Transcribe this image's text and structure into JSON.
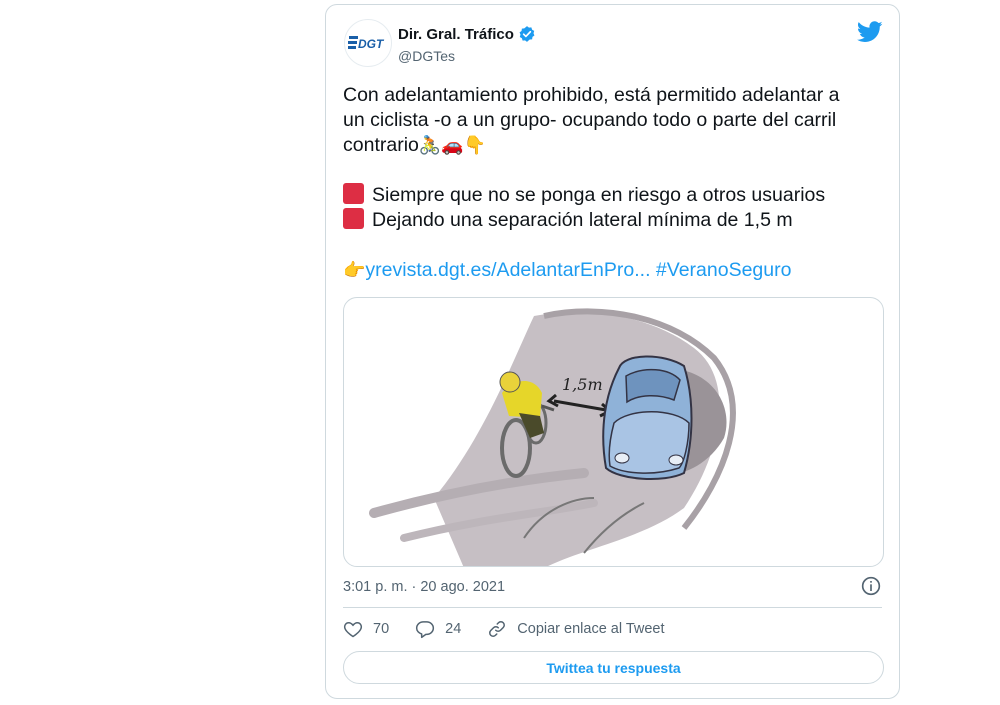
{
  "tweet": {
    "author_name": "Dir. Gral. Tráfico",
    "author_handle": "@DGTes",
    "logo_text": "DGT",
    "text_lines": [
      "Con adelantamiento prohibido, está permitido adelantar a",
      "un ciclista -o a un grupo- ocupando todo o parte del carril",
      "contrario"
    ],
    "emojis_after_text": "🚴🚗👇",
    "bullets": [
      "Siempre que no se ponga en riesgo a otros usuarios",
      "Dejando una separación lateral mínima de 1,5 m"
    ],
    "pointing_emoji": "👉",
    "link_text": "yrevista.dgt.es/AdelantarEnPro...",
    "hashtag": "#VeranoSeguro",
    "media_label": "1,5m",
    "timestamp": "3:01 p. m. · 20 ago. 2021"
  },
  "actions": {
    "likes": "70",
    "replies": "24",
    "copy_link_label": "Copiar enlace al Tweet"
  },
  "reply_button_label": "Twittea tu respuesta",
  "colors": {
    "accent": "#1d9bf0",
    "text": "#0f1419",
    "muted": "#536471",
    "border": "#cfd9de",
    "red_square": "#dd2e44",
    "dgt_blue": "#1a5fa8"
  },
  "icons": [
    "verified-badge-icon",
    "twitter-bird-icon",
    "info-icon",
    "heart-icon",
    "reply-icon",
    "link-icon"
  ]
}
